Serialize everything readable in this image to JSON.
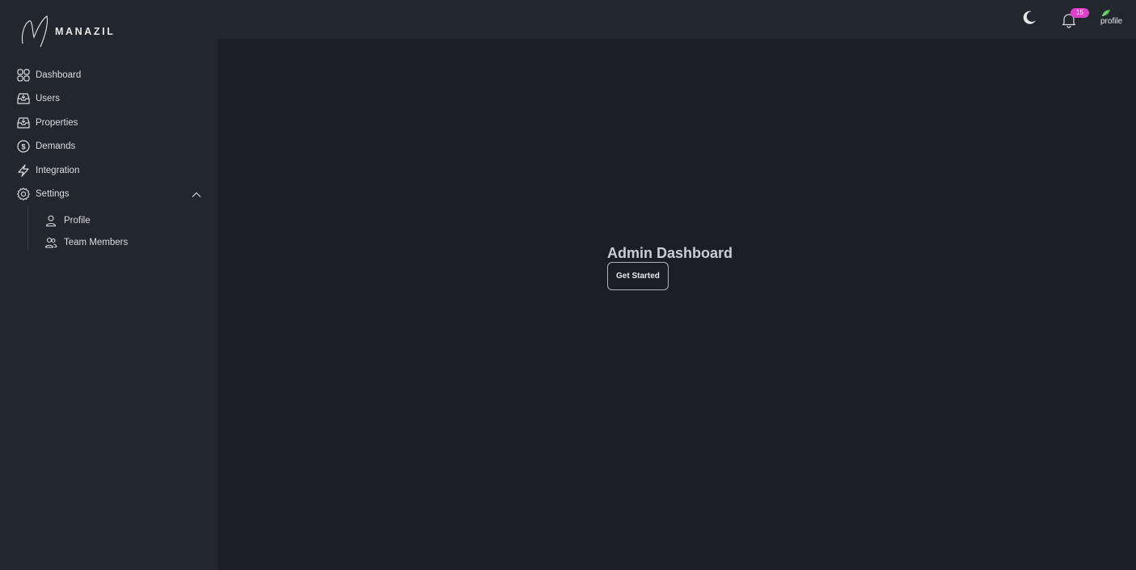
{
  "brand": {
    "name": "MANAZIL"
  },
  "sidebar": {
    "items": [
      {
        "label": "Dashboard",
        "icon": "grid-icon"
      },
      {
        "label": "Users",
        "icon": "inbox-icon"
      },
      {
        "label": "Properties",
        "icon": "inbox-icon"
      },
      {
        "label": "Demands",
        "icon": "dollar-icon"
      },
      {
        "label": "Integration",
        "icon": "bolt-icon"
      },
      {
        "label": "Settings",
        "icon": "gear-icon",
        "expanded": true
      }
    ],
    "submenu": [
      {
        "label": "Profile",
        "icon": "user-icon"
      },
      {
        "label": "Team Members",
        "icon": "users-icon"
      }
    ]
  },
  "header": {
    "notification_count": "15",
    "profile_alt": "profile"
  },
  "main": {
    "title": "Admin Dashboard",
    "cta_label": "Get Started"
  },
  "colors": {
    "background": "#1b1e25",
    "sidebar": "#22262d",
    "badge": "#e040c8",
    "avatar_leaf": "#4caf50"
  }
}
